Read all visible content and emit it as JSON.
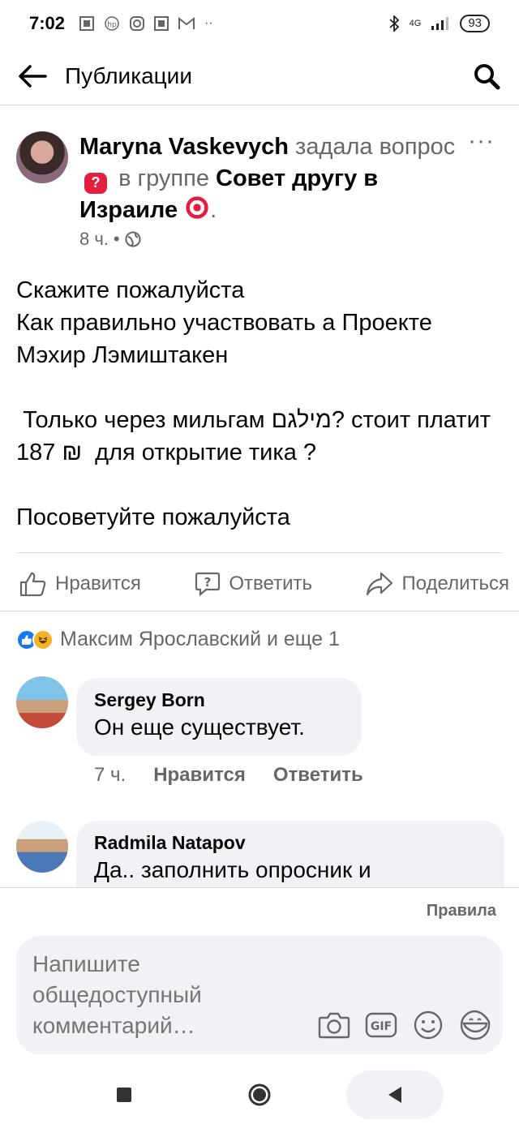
{
  "status_bar": {
    "time": "7:02",
    "network": "4G",
    "battery": "93",
    "notification_icons": [
      "qr-icon",
      "hp-icon",
      "instagram-icon",
      "qr-icon",
      "gmail-icon",
      "more-dots-icon"
    ]
  },
  "header": {
    "title": "Публикации",
    "back_icon": "arrow-left-icon",
    "search_icon": "search-icon"
  },
  "post": {
    "author": "Maryna Vaskevych",
    "asked": "задала вопрос",
    "in_group": "в группе",
    "group": "Совет другу в Израиле",
    "time": "8 ч.",
    "separator": "•",
    "body": [
      "Скажите пожалуйста\nКак правильно участвовать а Проекте Мэхир Лэмиштакен",
      " Только через мильгам מילגם? стоит платит 187 ₪  для открытие тика ?",
      "Посоветуйте пожалуйста"
    ]
  },
  "actions": {
    "like": "Нравится",
    "answer": "Ответить",
    "share": "Поделиться"
  },
  "reactions": {
    "summary": "Максим Ярославский и еще 1"
  },
  "comments": [
    {
      "author": "Sergey Born",
      "text": "Он еще существует.",
      "time": "7 ч.",
      "like": "Нравится",
      "reply": "Ответить"
    },
    {
      "author": "Radmila Natapov",
      "text": "Да.. заполнить опросник и"
    }
  ],
  "composer": {
    "rules": "Правила",
    "placeholder": "Напишите общедоступный комментарий…"
  },
  "colors": {
    "accent": "#1877f2",
    "text_secondary": "#65676b",
    "bubble_bg": "#f0f2f5",
    "emoji_red": "#e41e3f"
  }
}
